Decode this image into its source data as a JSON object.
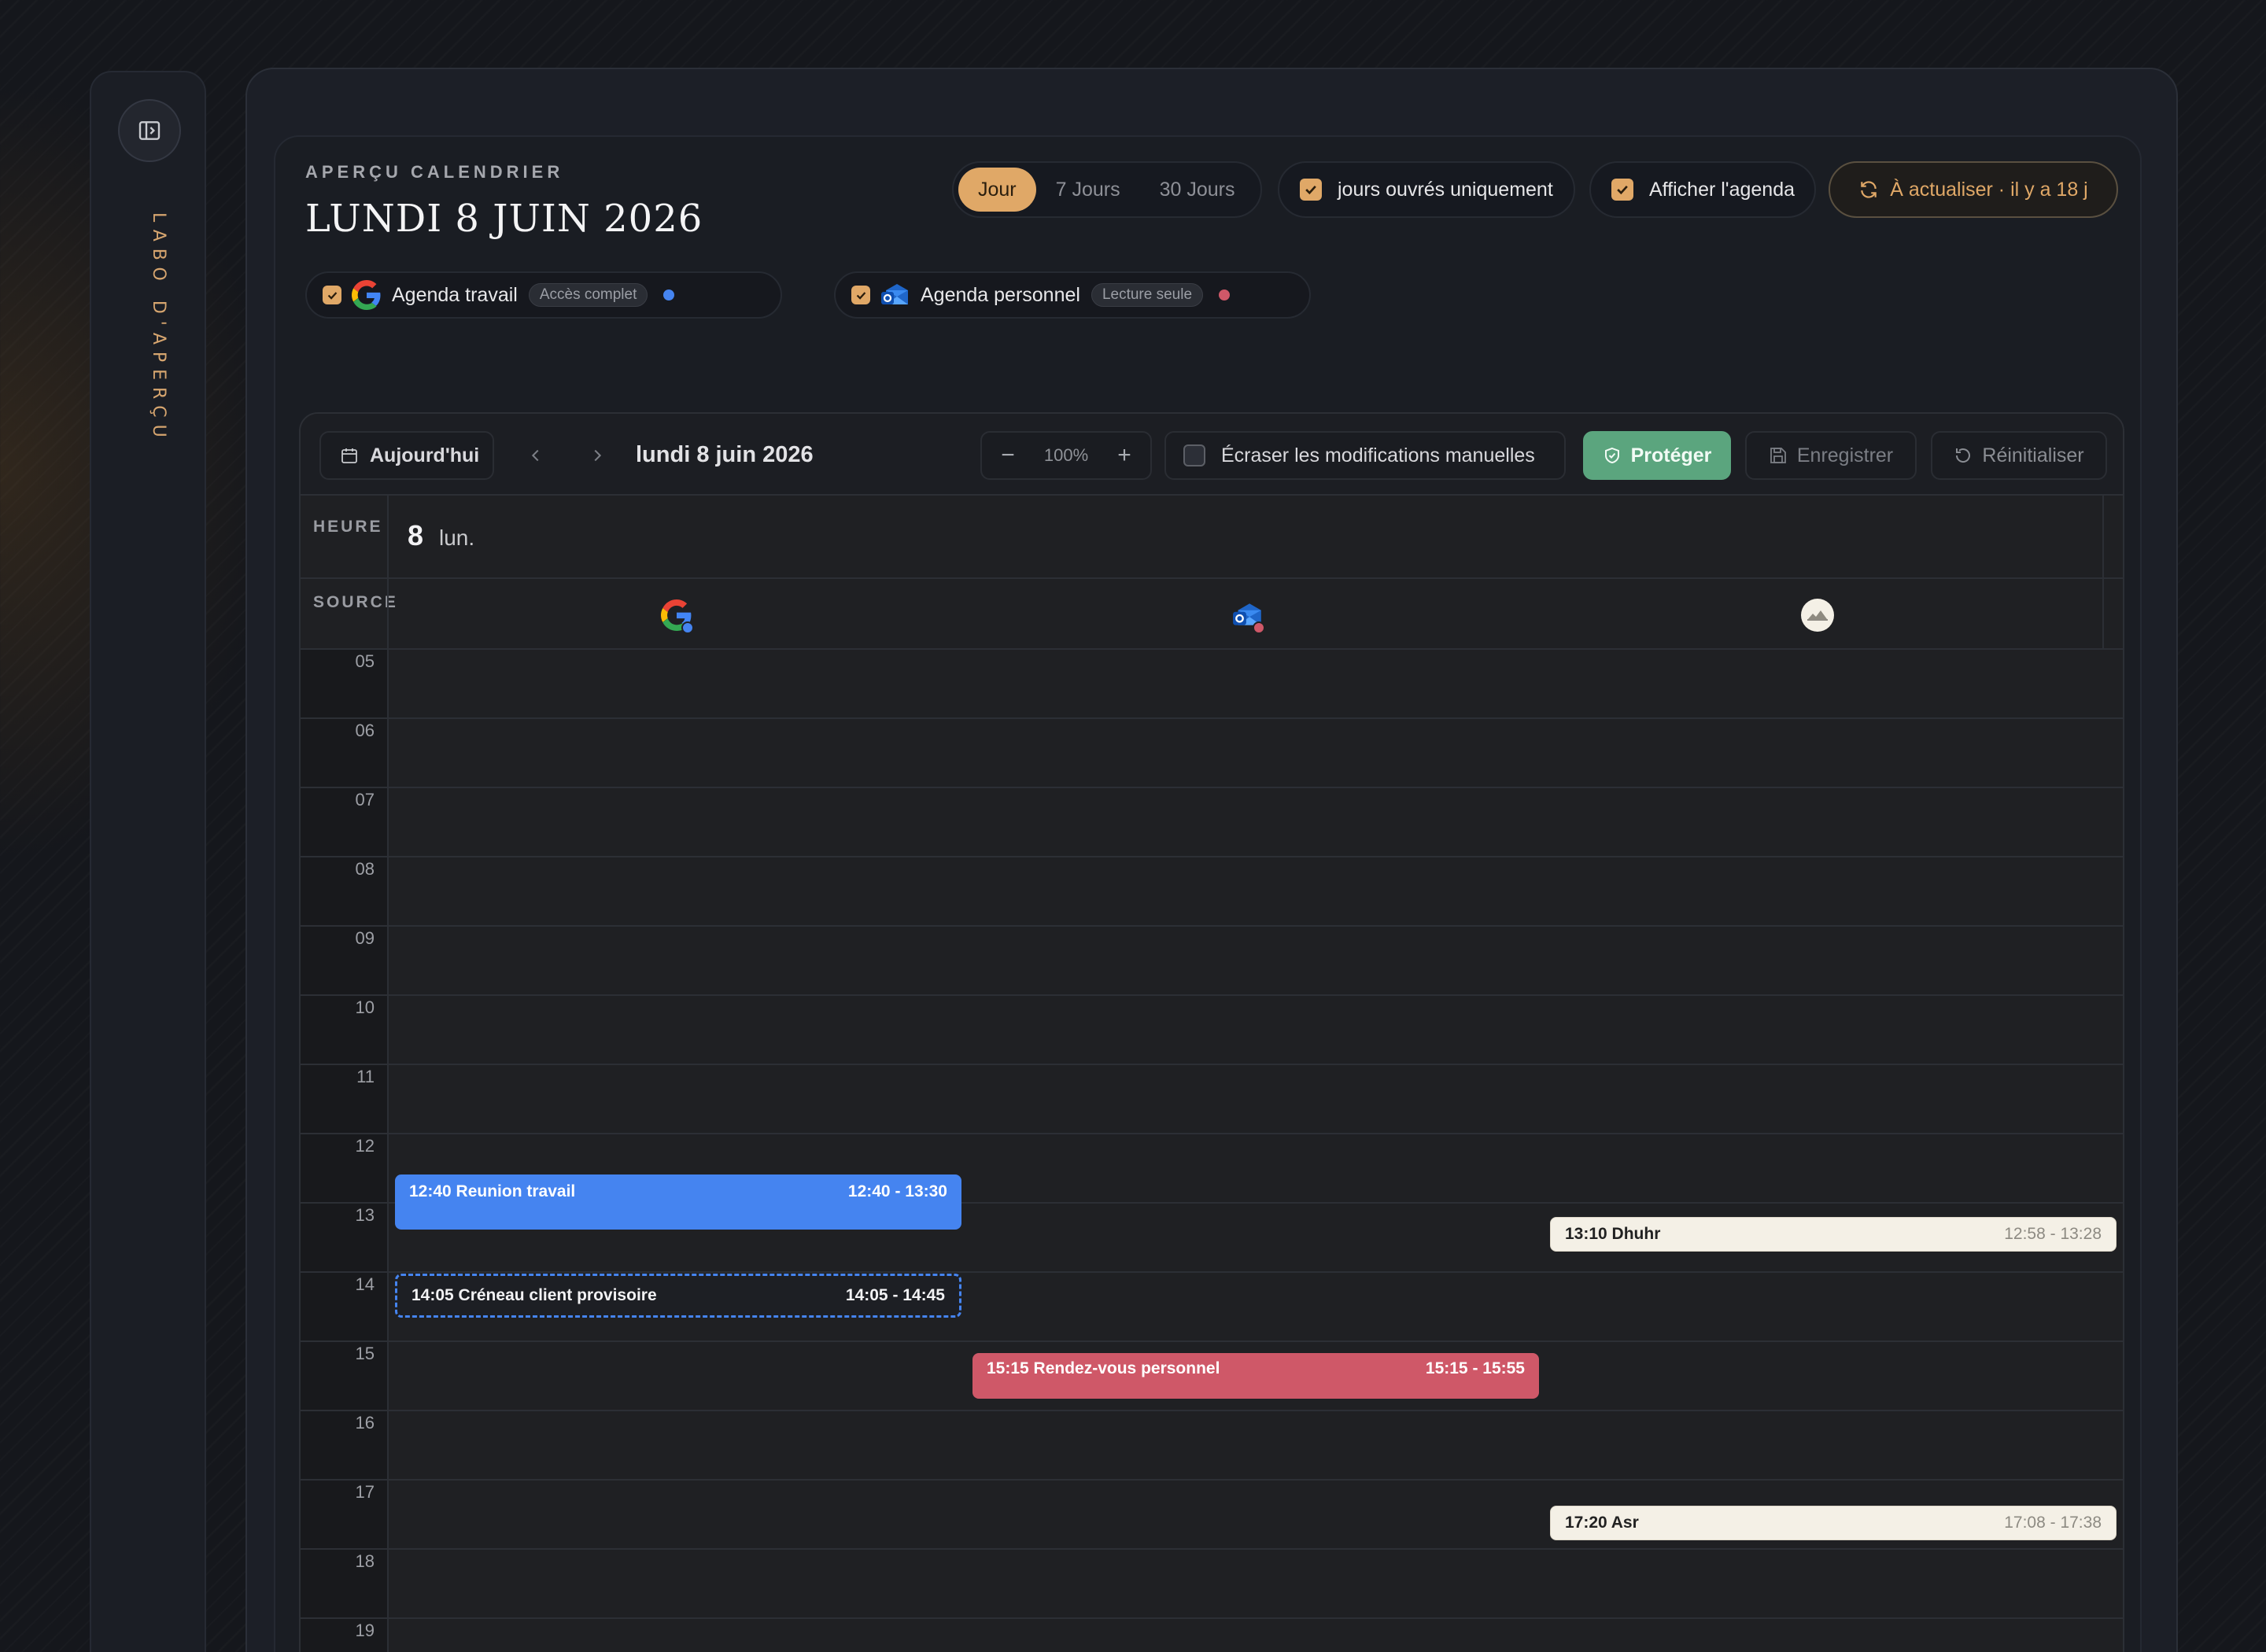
{
  "sidebar": {
    "label": "LABO D'APERÇU",
    "toggle_icon": "sidebar-toggle-icon"
  },
  "header": {
    "eyebrow": "APERÇU CALENDRIER",
    "title": "LUNDI 8 JUIN 2026",
    "views": [
      "Jour",
      "7 Jours",
      "30 Jours"
    ],
    "active_view": "Jour",
    "workdays_label": "jours ouvrés uniquement",
    "workdays_checked": true,
    "show_agenda_label": "Afficher l'agenda",
    "show_agenda_checked": true,
    "refresh_label": "À actualiser · il y a 18 j"
  },
  "sources": [
    {
      "name": "Agenda travail",
      "badge": "Accès complet",
      "color": "#4584f0",
      "checked": true,
      "icon": "google-icon"
    },
    {
      "name": "Agenda personnel",
      "badge": "Lecture seule",
      "color": "#cf5868",
      "checked": true,
      "icon": "outlook-icon"
    }
  ],
  "toolbar": {
    "today_label": "Aujourd'hui",
    "date_label": "lundi 8 juin 2026",
    "zoom": "100%",
    "overwrite_label": "Écraser les modifications manuelles",
    "overwrite_checked": false,
    "protect_label": "Protéger",
    "save_label": "Enregistrer",
    "reset_label": "Réinitialiser"
  },
  "grid": {
    "hour_header": "HEURE",
    "source_header": "SOURCE",
    "day_number": "8",
    "day_name": "lun.",
    "hours": [
      "05",
      "06",
      "07",
      "08",
      "09",
      "10",
      "11",
      "12",
      "13",
      "14",
      "15",
      "16",
      "17",
      "18",
      "19"
    ]
  },
  "events": [
    {
      "title": "12:40 Reunion travail",
      "time": "12:40 - 13:30",
      "style": "blue",
      "column": 0,
      "start": "12:40",
      "end": "13:30"
    },
    {
      "title": "14:05 Créneau client provisoire",
      "time": "14:05 - 14:45",
      "style": "dashed",
      "column": 0,
      "start": "14:05",
      "end": "14:45"
    },
    {
      "title": "15:15 Rendez-vous personnel",
      "time": "15:15 - 15:55",
      "style": "red",
      "column": 1,
      "start": "15:15",
      "end": "15:55"
    },
    {
      "title": "13:10 Dhuhr",
      "time": "12:58 - 13:28",
      "style": "cream",
      "column": 2,
      "start": "12:58",
      "end": "13:28"
    },
    {
      "title": "17:20 Asr",
      "time": "17:08 - 17:38",
      "style": "cream",
      "column": 2,
      "start": "17:08",
      "end": "17:38"
    }
  ]
}
